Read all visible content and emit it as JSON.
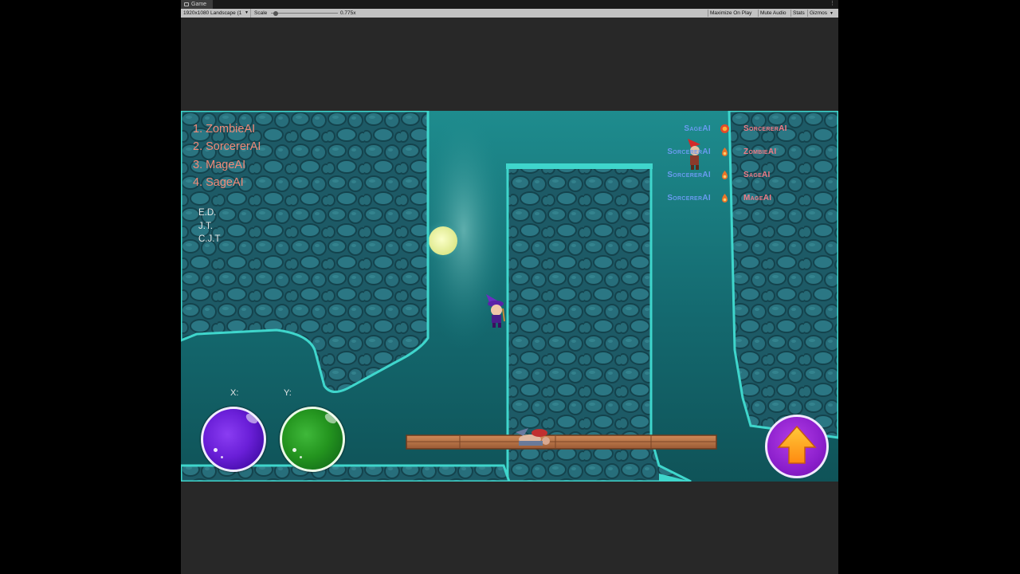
{
  "window": {
    "tab_title": "Game",
    "tab_menu_glyph": "⋮"
  },
  "toolbar": {
    "resolution": "1920x1080 Landscape (1",
    "scale_label": "Scale",
    "scale_value": "0.775x",
    "scale_level": 0.02,
    "maximize_label": "Maximize On Play",
    "mute_label": "Mute Audio",
    "stats_label": "Stats",
    "gizmos_label": "Gizmos"
  },
  "hud": {
    "leaderboard": [
      "1. ZombieAI",
      "2. SorcererAI",
      "3. MageAI",
      "4. SageAI"
    ],
    "credits": [
      "E.D.",
      "J.T.",
      "C.J.T"
    ],
    "x_label": "X:",
    "y_label": "Y:",
    "killfeed": [
      {
        "killer": "SageAI",
        "victim": "SorcererAI",
        "icon": "fireball-icon"
      },
      {
        "killer": "SorcererAI",
        "victim": "ZombieAI",
        "icon": "fire-icon"
      },
      {
        "killer": "SorcererAI",
        "victim": "SageAI",
        "icon": "fire-icon"
      },
      {
        "killer": "SorcererAI",
        "victim": "MageAI",
        "icon": "fire-icon"
      }
    ],
    "jump_icon": "up-arrow-icon"
  },
  "colors": {
    "rank_text": "#f08a78",
    "killer_text": "#6a9bf0",
    "victim_text": "#f07a86",
    "cave_edge": "#3fd6cc",
    "platform": "#b9754a"
  }
}
